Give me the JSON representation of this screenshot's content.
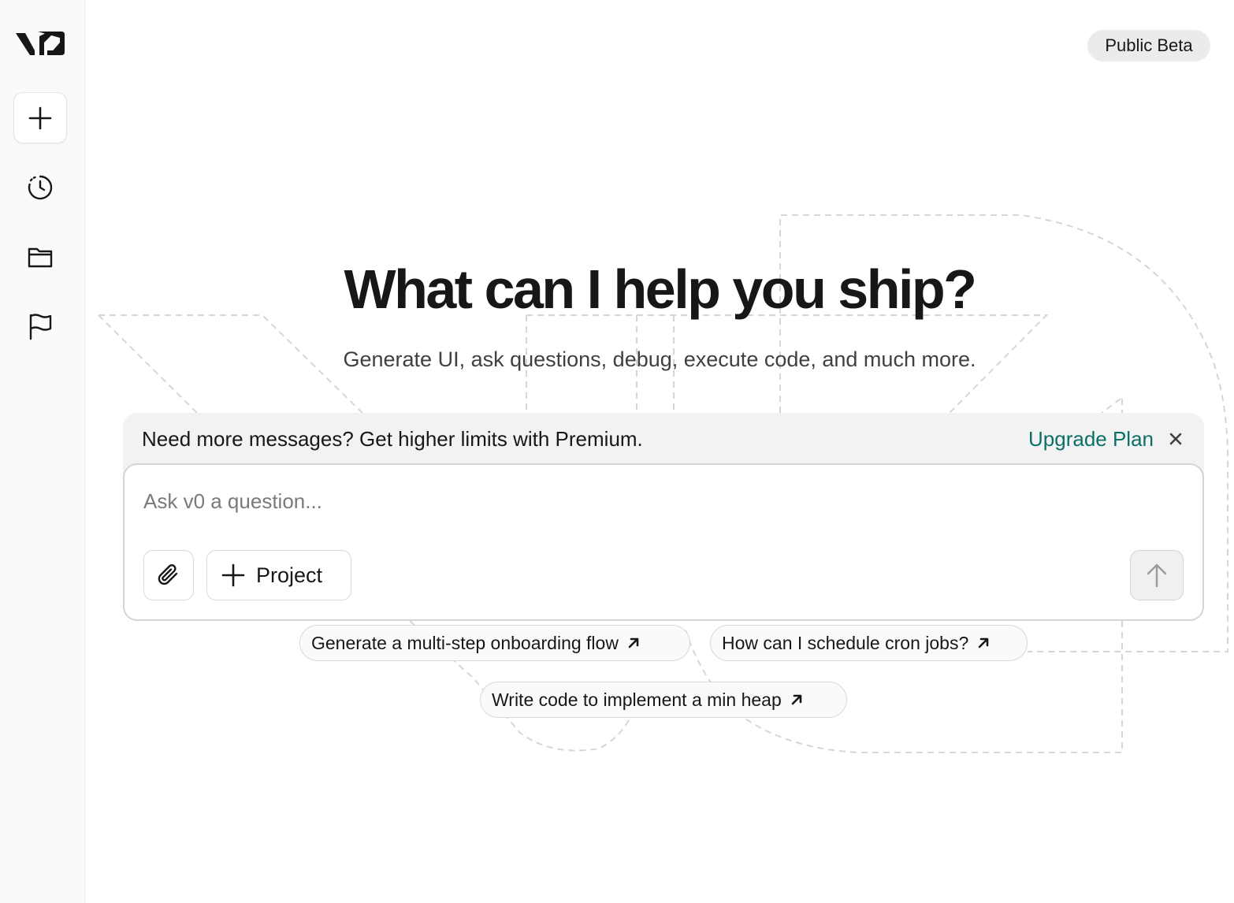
{
  "app": {
    "logo": "v0"
  },
  "sidebar": {
    "items": [
      {
        "name": "new-chat",
        "icon": "plus-icon"
      },
      {
        "name": "history",
        "icon": "history-icon"
      },
      {
        "name": "projects",
        "icon": "folder-icon"
      },
      {
        "name": "feedback",
        "icon": "flag-icon"
      }
    ]
  },
  "header": {
    "badge": "Public Beta"
  },
  "hero": {
    "title": "What can I help you ship?",
    "subtitle": "Generate UI, ask questions, debug, execute code, and much more."
  },
  "banner": {
    "message": "Need more messages? Get higher limits with Premium.",
    "action": "Upgrade Plan",
    "close_icon": "close-icon"
  },
  "composer": {
    "placeholder": "Ask v0 a question...",
    "attach_icon": "paperclip-icon",
    "project_label": "Project",
    "send_icon": "arrow-up-icon"
  },
  "suggestions": [
    {
      "label": "Generate a multi-step onboarding flow",
      "icon": "arrow-up-right-icon"
    },
    {
      "label": "How can I schedule cron jobs?",
      "icon": "arrow-up-right-icon"
    },
    {
      "label": "Write code to implement a min heap",
      "icon": "arrow-up-right-icon"
    }
  ],
  "colors": {
    "accent": "#0b7065",
    "text": "#171717",
    "sidebar_bg": "#fafafa",
    "banner_bg": "#f2f2f2"
  }
}
